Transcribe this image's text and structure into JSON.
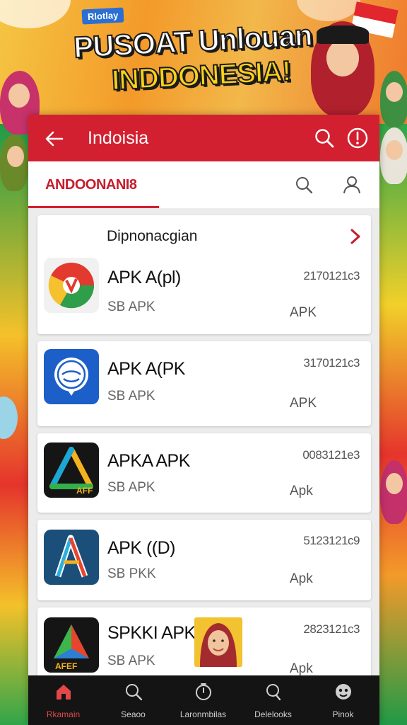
{
  "poster": {
    "badge": "Rlotlay",
    "headline_line1": "PUSOAT Unlouan",
    "headline_line2": "INDDONESIA!"
  },
  "appbar": {
    "title": "Indoisia",
    "back_icon": "arrow-left-icon",
    "search_icon": "search-icon",
    "info_icon": "info-icon"
  },
  "tabs": {
    "active_label": "ANDOONANI8",
    "search_icon": "search-icon",
    "user_icon": "user-icon"
  },
  "section": {
    "title": "Dipnonacgian"
  },
  "apps": [
    {
      "name": "APK A(pl)",
      "sub": "SB APK",
      "number": "2170121c3",
      "tag": "APK"
    },
    {
      "name": "APK A(PK",
      "sub": "SB APK",
      "number": "3170121c3",
      "tag": "APK"
    },
    {
      "name": "APKA APK",
      "sub": "SB APK",
      "number": "0083121e3",
      "tag": "Apk"
    },
    {
      "name": "APK ((D)",
      "sub": "SB PKK",
      "number": "5123121c9",
      "tag": "Apk"
    },
    {
      "name": "SPKKI APK",
      "sub": "SB APK",
      "number": "2823121c3",
      "tag": "Apk"
    }
  ],
  "bottom_nav": [
    {
      "label": "Rkamain",
      "icon": "home-icon",
      "active": true
    },
    {
      "label": "Seaoo",
      "icon": "search-icon",
      "active": false
    },
    {
      "label": "Laronmbilas",
      "icon": "timer-icon",
      "active": false
    },
    {
      "label": "Delelooks",
      "icon": "search-icon",
      "active": false
    },
    {
      "label": "Pinok",
      "icon": "face-icon",
      "active": false
    }
  ],
  "colors": {
    "brand_red": "#d32030",
    "nav_bg": "#141414",
    "active_nav": "#e2474a"
  }
}
